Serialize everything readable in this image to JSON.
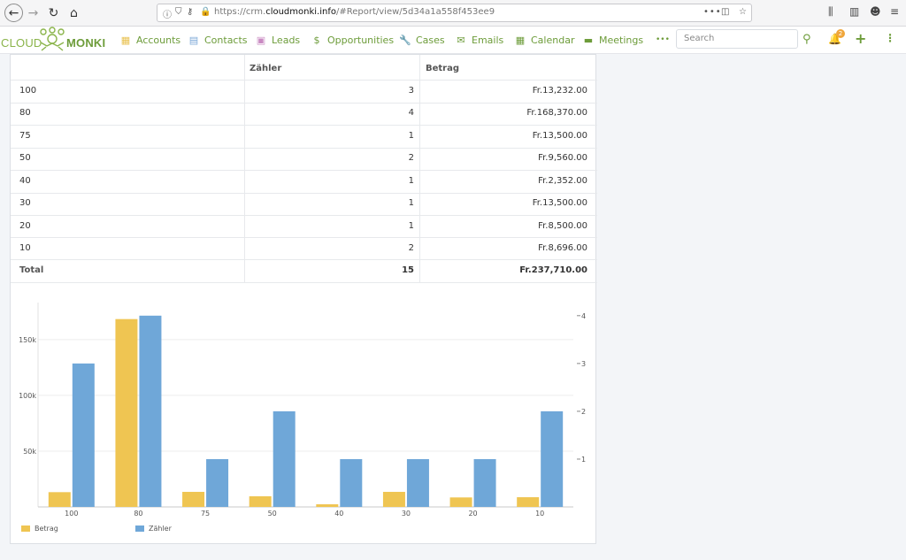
{
  "browser": {
    "url_prefix": "https://crm.",
    "url_domain": "cloudmonki.info",
    "url_path": "/#Report/view/5d34a1a558f453ee9"
  },
  "app": {
    "logo_left": "CLOUD",
    "logo_right": "MONKI",
    "nav": [
      {
        "label": "Accounts",
        "icon": "building-icon",
        "color": "#e8c14f"
      },
      {
        "label": "Contacts",
        "icon": "contact-card-icon",
        "color": "#7aa7d6"
      },
      {
        "label": "Leads",
        "icon": "lead-card-icon",
        "color": "#c98ac2"
      },
      {
        "label": "Opportunities",
        "icon": "dollar-icon",
        "color": "#6d9c3a"
      },
      {
        "label": "Cases",
        "icon": "wrench-icon",
        "color": "#6d9c3a"
      },
      {
        "label": "Emails",
        "icon": "envelope-icon",
        "color": "#6d9c3a"
      },
      {
        "label": "Calendar",
        "icon": "calendar-icon",
        "color": "#6d9c3a"
      },
      {
        "label": "Meetings",
        "icon": "briefcase-icon",
        "color": "#6d9c3a"
      }
    ],
    "more_label": "•••",
    "search_placeholder": "Search",
    "notification_count": "2",
    "accent": "#6d9c3a"
  },
  "report": {
    "columns": [
      "",
      "Zähler",
      "Betrag"
    ],
    "rows": [
      {
        "group": "100",
        "count": "3",
        "amount": "Fr.13,232.00"
      },
      {
        "group": "80",
        "count": "4",
        "amount": "Fr.168,370.00"
      },
      {
        "group": "75",
        "count": "1",
        "amount": "Fr.13,500.00"
      },
      {
        "group": "50",
        "count": "2",
        "amount": "Fr.9,560.00"
      },
      {
        "group": "40",
        "count": "1",
        "amount": "Fr.2,352.00"
      },
      {
        "group": "30",
        "count": "1",
        "amount": "Fr.13,500.00"
      },
      {
        "group": "20",
        "count": "1",
        "amount": "Fr.8,500.00"
      },
      {
        "group": "10",
        "count": "2",
        "amount": "Fr.8,696.00"
      }
    ],
    "total": {
      "label": "Total",
      "count": "15",
      "amount": "Fr.237,710.00"
    }
  },
  "chart_data": {
    "type": "bar",
    "categories": [
      "100",
      "80",
      "75",
      "50",
      "40",
      "30",
      "20",
      "10"
    ],
    "series": [
      {
        "name": "Betrag",
        "values": [
          13232,
          168370,
          13500,
          9560,
          2352,
          13500,
          8500,
          8696
        ],
        "color": "#efc552",
        "axis": "left"
      },
      {
        "name": "Zähler",
        "values": [
          3,
          4,
          1,
          2,
          1,
          1,
          1,
          2
        ],
        "color": "#6fa7d8",
        "axis": "right"
      }
    ],
    "y_left": {
      "ticks": [
        "50k",
        "100k",
        "150k"
      ],
      "tick_values": [
        50000,
        100000,
        150000
      ],
      "lim": [
        0,
        180000
      ]
    },
    "y_right": {
      "ticks": [
        "1",
        "2",
        "3",
        "4"
      ],
      "tick_values": [
        1,
        2,
        3,
        4
      ],
      "lim": [
        0,
        4.2
      ]
    },
    "grid": true,
    "legend": "bottom-left"
  }
}
